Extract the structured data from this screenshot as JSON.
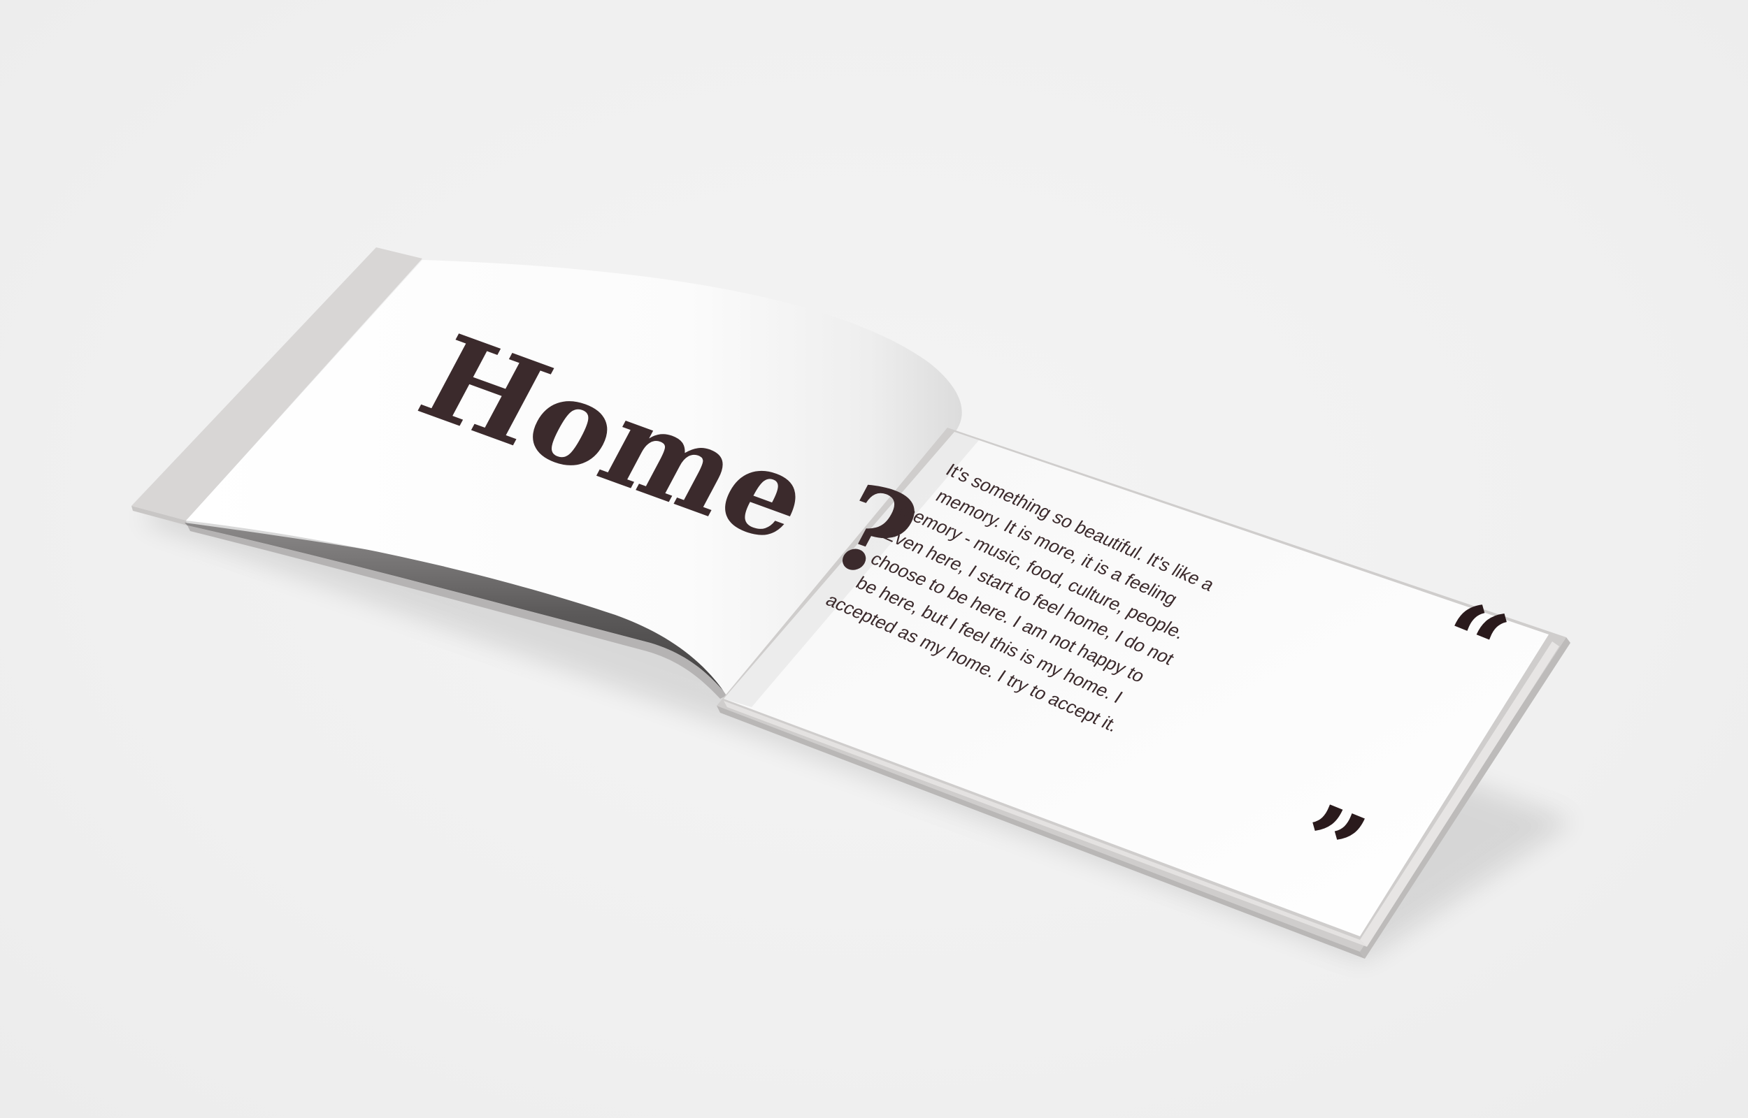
{
  "book": {
    "left_page": {
      "title": "Home ?"
    },
    "right_page": {
      "quote_lines": [
        "It's something so beautiful. It's like a",
        "memory. It is more, it is a feeling",
        "memory - music, food, culture, people.",
        "Even here, I start to feel home, I do not",
        "choose to be here. I am not happy to",
        "be here, but I feel this is my home. I",
        "accepted as my home. I try to accept it."
      ],
      "open_quote": "“",
      "close_quote": "”"
    }
  },
  "colors": {
    "background": "#f1f1f1",
    "ink": "#3b2a2c",
    "page": "#ffffff",
    "cover_edge": "#d9d7d6"
  }
}
